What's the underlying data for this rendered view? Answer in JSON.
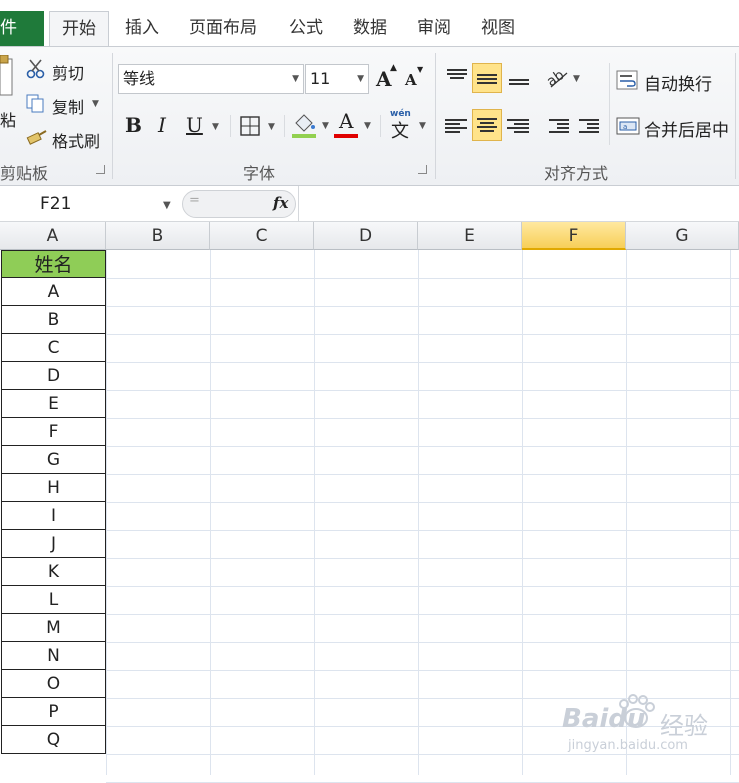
{
  "tabs": {
    "file": "件",
    "home": "开始",
    "insert": "插入",
    "page_layout": "页面布局",
    "formulas": "公式",
    "data": "数据",
    "review": "审阅",
    "view": "视图"
  },
  "clipboard": {
    "paste": "粘",
    "cut": "剪切",
    "copy": "复制",
    "format_painter": "格式刷",
    "group_label": "剪贴板"
  },
  "font": {
    "name": "等线",
    "size": "11",
    "bold": "B",
    "italic": "I",
    "underline": "U",
    "font_color_glyph": "A",
    "grow_glyph": "A",
    "shrink_glyph": "A",
    "phonetic_top": "wén",
    "phonetic_char": "文",
    "group_label": "字体",
    "fill_color": "#92d050",
    "font_color": "#e00000"
  },
  "alignment": {
    "wrap_text": "自动换行",
    "merge_center": "合并后居中",
    "group_label": "对齐方式"
  },
  "formula_bar": {
    "name_box": "F21",
    "equals_glyph": "=",
    "fx": "fx"
  },
  "columns": [
    "A",
    "B",
    "C",
    "D",
    "E",
    "F",
    "G"
  ],
  "selected_column": "F",
  "sheet": {
    "header": "姓名",
    "header_fill": "#8fcd57",
    "names": [
      "A",
      "B",
      "C",
      "D",
      "E",
      "F",
      "G",
      "H",
      "I",
      "J",
      "K",
      "L",
      "M",
      "N",
      "O",
      "P",
      "Q"
    ]
  },
  "watermark": {
    "brand": "Baidu",
    "brand_cn": "经验",
    "url": "jingyan.baidu.com"
  }
}
